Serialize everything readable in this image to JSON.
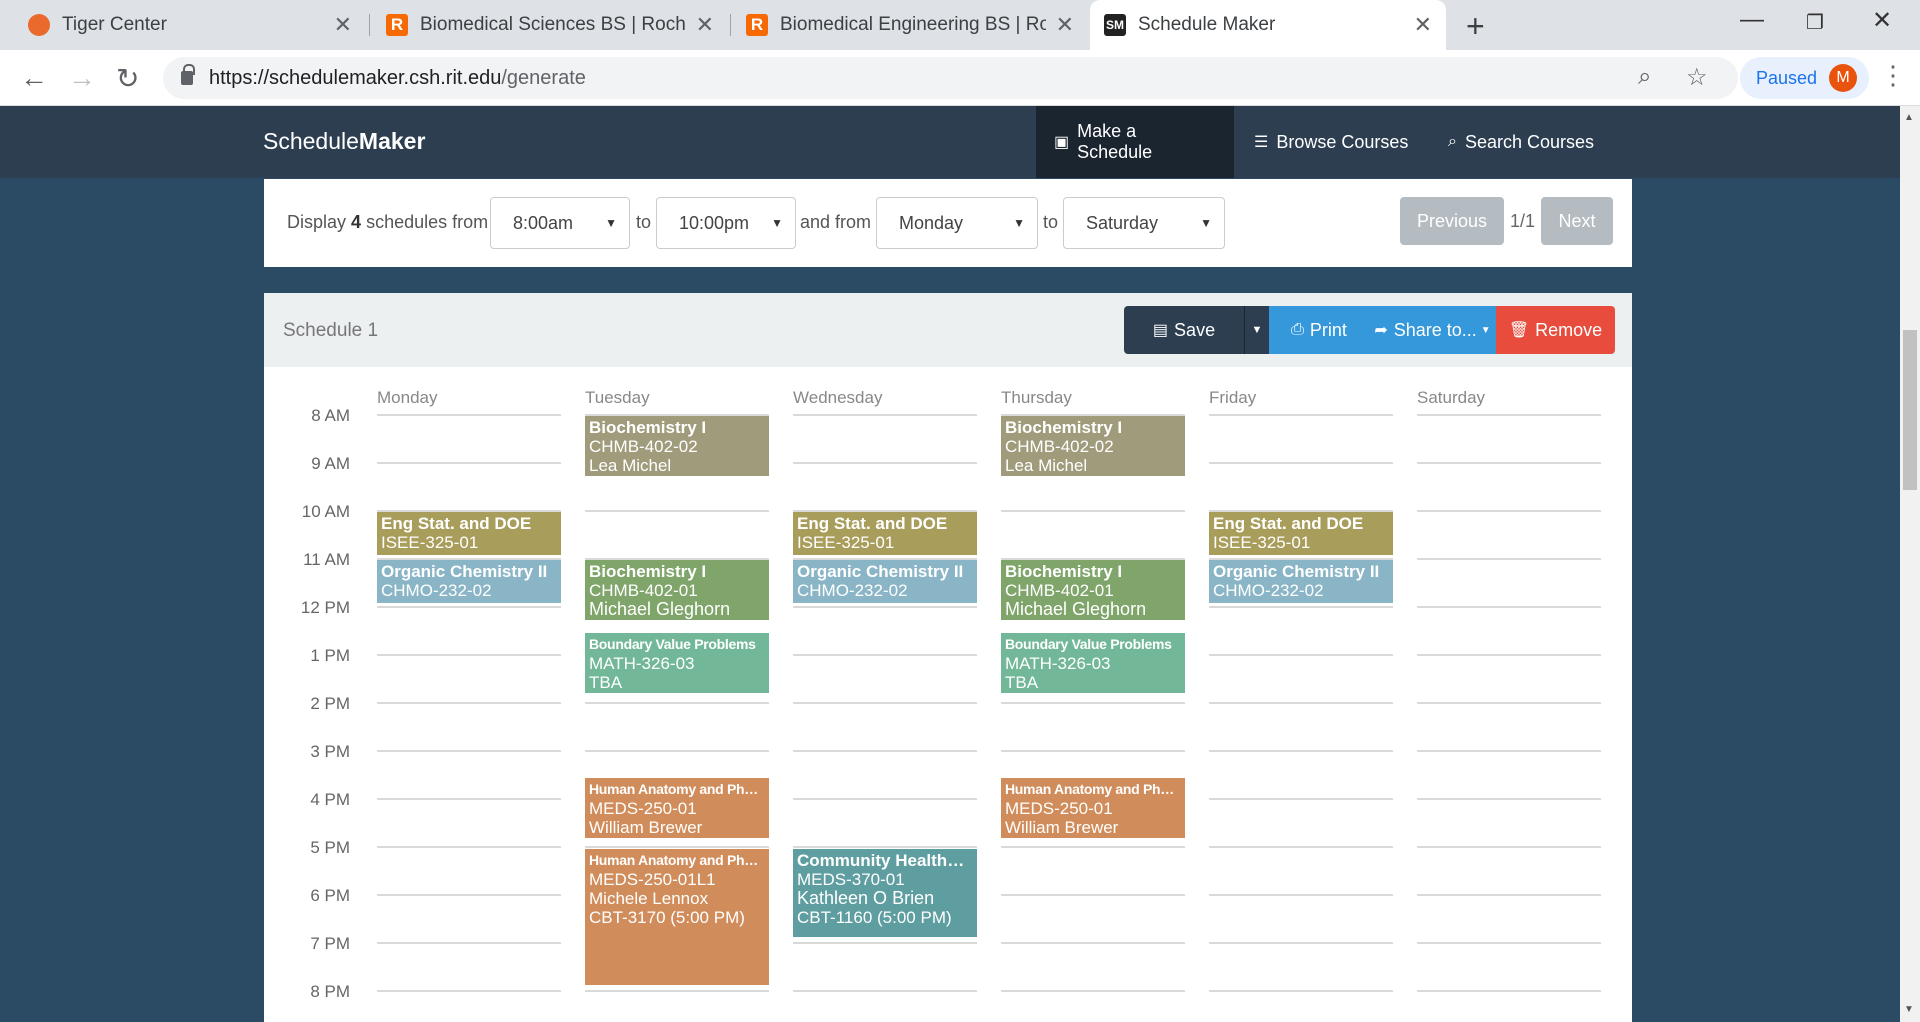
{
  "browser": {
    "tabs": [
      {
        "title": "Tiger Center",
        "favicon": "tiger-icon"
      },
      {
        "title": "Biomedical Sciences BS | Rochest",
        "favicon": "rit-icon"
      },
      {
        "title": "Biomedical Engineering BS | Roch",
        "favicon": "rit-icon"
      },
      {
        "title": "Schedule Maker",
        "favicon": "schedulemaker-icon"
      }
    ],
    "url_host": "https://schedulemaker.csh.rit.edu",
    "url_path": "/generate",
    "profile_label": "Paused",
    "profile_initial": "M"
  },
  "navbar": {
    "brand_light": "Schedule",
    "brand_bold": "Maker",
    "links": [
      {
        "label": "Make a Schedule",
        "icon": "calendar-icon"
      },
      {
        "label": "Browse Courses",
        "icon": "list-icon"
      },
      {
        "label": "Search Courses",
        "icon": "search-icon"
      }
    ]
  },
  "filter": {
    "display_prefix": "Display",
    "display_count": "4",
    "display_suffix": "schedules from",
    "start_time": "8:00am",
    "to_label": "to",
    "end_time": "10:00pm",
    "and_from_label": "and from",
    "start_day": "Monday",
    "to_label_2": "to",
    "end_day": "Saturday",
    "previous_label": "Previous",
    "page_indicator": "1/1",
    "next_label": "Next"
  },
  "schedule": {
    "title": "Schedule 1",
    "save_label": "Save",
    "print_label": "Print",
    "share_label": "Share to...",
    "remove_label": "Remove",
    "days": [
      "Monday",
      "Tuesday",
      "Wednesday",
      "Thursday",
      "Friday",
      "Saturday"
    ],
    "times": [
      "8 AM",
      "9 AM",
      "10 AM",
      "11 AM",
      "12 PM",
      "1 PM",
      "2 PM",
      "3 PM",
      "4 PM",
      "5 PM",
      "6 PM",
      "7 PM",
      "8 PM"
    ],
    "colors": {
      "biochem": "#a09b7b",
      "engstat": "#a89d5a",
      "orgchem": "#89b5c7",
      "biochem_lab": "#7fa56a",
      "bvp": "#72b898",
      "anatomy": "#d08c5a",
      "community": "#5f9ea0"
    },
    "courses": [
      {
        "name": "Biochemistry I",
        "code": "CHMB-402-02",
        "instructor": "Lea Michel",
        "extra": ""
      },
      {
        "name": "Biochemistry I",
        "code": "CHMB-402-02",
        "instructor": "Lea Michel",
        "extra": ""
      },
      {
        "name": "Eng Stat. and DOE",
        "code": "ISEE-325-01",
        "instructor": "",
        "extra": ""
      },
      {
        "name": "Eng Stat. and DOE",
        "code": "ISEE-325-01",
        "instructor": "",
        "extra": ""
      },
      {
        "name": "Eng Stat. and DOE",
        "code": "ISEE-325-01",
        "instructor": "",
        "extra": ""
      },
      {
        "name": "Organic Chemistry II",
        "code": "CHMO-232-02",
        "instructor": "",
        "extra": ""
      },
      {
        "name": "Organic Chemistry II",
        "code": "CHMO-232-02",
        "instructor": "",
        "extra": ""
      },
      {
        "name": "Organic Chemistry II",
        "code": "CHMO-232-02",
        "instructor": "",
        "extra": ""
      },
      {
        "name": "Biochemistry I",
        "code": "CHMB-402-01",
        "instructor": "Michael Gleghorn",
        "extra": ""
      },
      {
        "name": "Biochemistry I",
        "code": "CHMB-402-01",
        "instructor": "Michael Gleghorn",
        "extra": ""
      },
      {
        "name": "Boundary Value Problems",
        "code": "MATH-326-03",
        "instructor": "TBA",
        "extra": ""
      },
      {
        "name": "Boundary Value Problems",
        "code": "MATH-326-03",
        "instructor": "TBA",
        "extra": ""
      },
      {
        "name": "Human Anatomy and Phys...",
        "code": "MEDS-250-01",
        "instructor": "William Brewer",
        "extra": ""
      },
      {
        "name": "Human Anatomy and Phys...",
        "code": "MEDS-250-01",
        "instructor": "William Brewer",
        "extra": ""
      },
      {
        "name": "Human Anatomy and Phys...",
        "code": "MEDS-250-01L1",
        "instructor": "Michele Lennox",
        "extra": "CBT-3170 (5:00 PM)"
      },
      {
        "name": "Community Healthcare",
        "code": "MEDS-370-01",
        "instructor": "Kathleen O Brien",
        "extra": "CBT-1160 (5:00 PM)"
      }
    ]
  }
}
